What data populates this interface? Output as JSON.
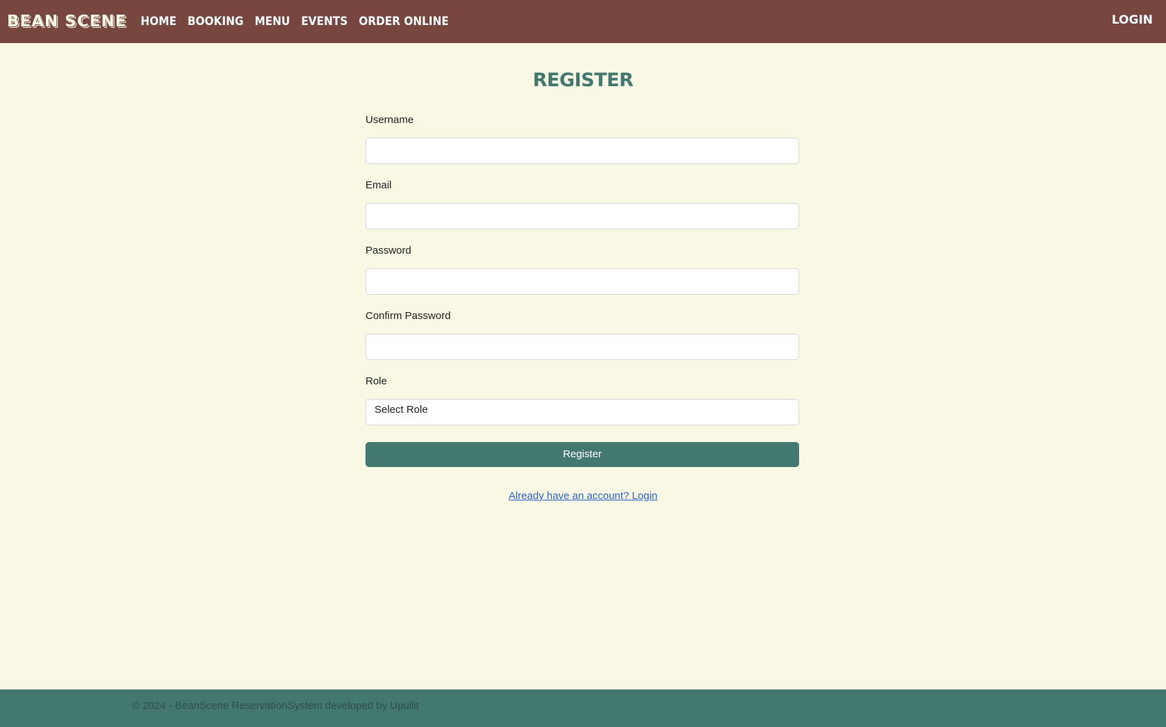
{
  "navbar": {
    "brand": "BEAN SCENE",
    "links": [
      "Home",
      "Booking",
      "Menu",
      "Events",
      "Order Online"
    ],
    "login": "Login"
  },
  "page": {
    "title": "Register"
  },
  "form": {
    "username_label": "Username",
    "email_label": "Email",
    "password_label": "Password",
    "confirm_password_label": "Confirm Password",
    "role_label": "Role",
    "role_selected": "Select Role",
    "submit_label": "Register",
    "login_link": "Already have an account? Login"
  },
  "footer": {
    "text": "© 2024 - BeanScene ReservationSystem developed by Upullit"
  },
  "colors": {
    "navbar_bg": "#77463f",
    "page_bg": "#f8f8e4",
    "accent": "#437870",
    "link": "#2d63c8"
  }
}
